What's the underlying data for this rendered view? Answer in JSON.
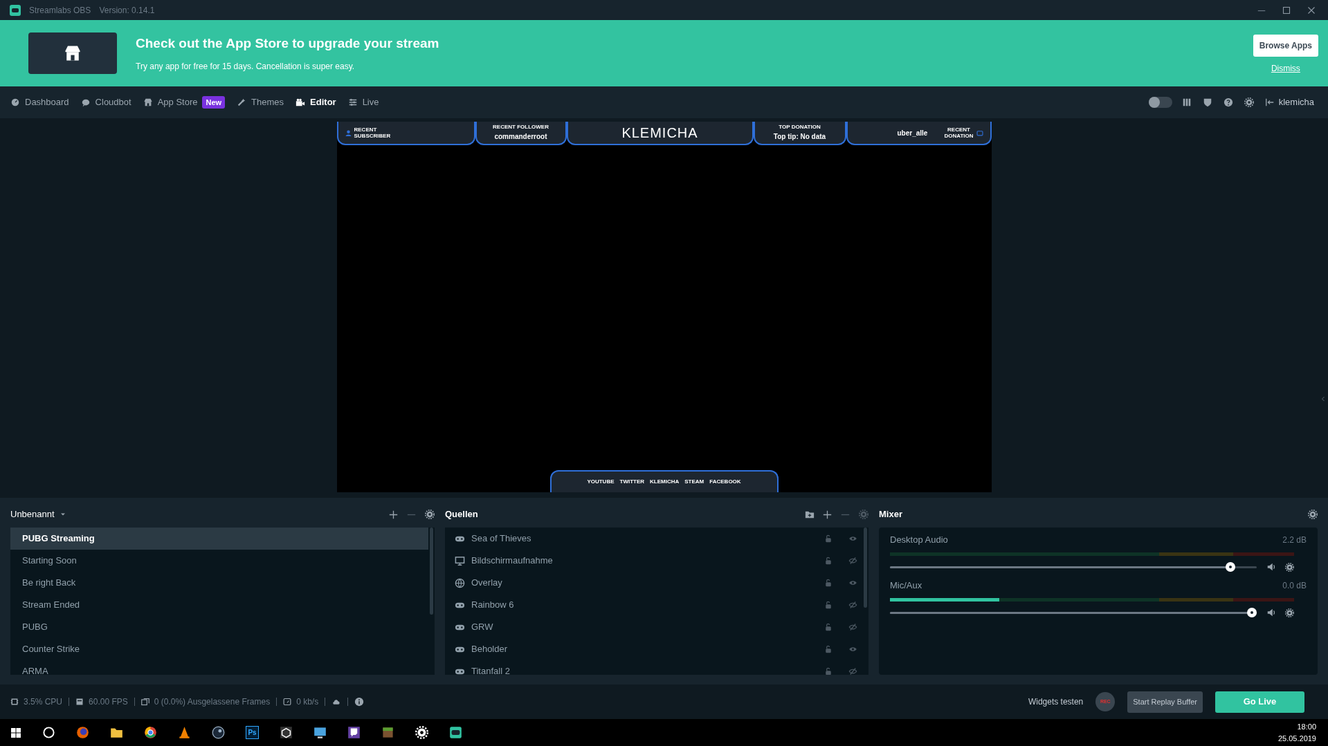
{
  "window": {
    "title": "Streamlabs OBS",
    "version": "Version: 0.14.1"
  },
  "banner": {
    "title": "Check out the App Store to upgrade your stream",
    "subtitle": "Try any app for free for 15 days. Cancellation is super easy.",
    "browse_button": "Browse Apps",
    "dismiss_link": "Dismiss"
  },
  "nav": {
    "items": [
      {
        "kind": "dashboard",
        "label": "Dashboard",
        "selected": false
      },
      {
        "kind": "cloudbot",
        "label": "Cloudbot",
        "selected": false
      },
      {
        "kind": "appstore",
        "label": "App Store",
        "badge": "New",
        "selected": false
      },
      {
        "kind": "themes",
        "label": "Themes",
        "selected": false
      },
      {
        "kind": "editor",
        "label": "Editor",
        "selected": true
      },
      {
        "kind": "live",
        "label": "Live",
        "selected": false
      }
    ],
    "night_mode": false,
    "user": "klemicha"
  },
  "overlay": {
    "top": [
      {
        "kind": "label",
        "lines": [
          "RECENT",
          "SUBSCRIBER"
        ]
      },
      {
        "kind": "stat",
        "caption": "RECENT FOLLOWER",
        "value": "commanderroot"
      },
      {
        "kind": "logo",
        "value": "KLEMICHA"
      },
      {
        "kind": "stat",
        "caption": "TOP DONATION",
        "value": "Top tip: No data"
      },
      {
        "kind": "stat-right",
        "value": "uber_alle",
        "lines": [
          "RECENT",
          "DONATION"
        ]
      }
    ],
    "socials": [
      "YOUTUBE",
      "TWITTER",
      "KLEMICHA",
      "STEAM",
      "FACEBOOK"
    ]
  },
  "scenes": {
    "collection": "Unbenannt",
    "items": [
      {
        "label": "PUBG Streaming",
        "selected": true
      },
      {
        "label": "Starting Soon",
        "selected": false
      },
      {
        "label": "Be right Back",
        "selected": false
      },
      {
        "label": "Stream Ended",
        "selected": false
      },
      {
        "label": "PUBG",
        "selected": false
      },
      {
        "label": "Counter Strike",
        "selected": false
      },
      {
        "label": "ARMA",
        "selected": false
      }
    ]
  },
  "sources": {
    "title": "Quellen",
    "items": [
      {
        "kind": "game",
        "label": "Sea of Thieves",
        "visible": true
      },
      {
        "kind": "display",
        "label": "Bildschirmaufnahme",
        "visible": false
      },
      {
        "kind": "browser",
        "label": "Overlay",
        "visible": true
      },
      {
        "kind": "game",
        "label": "Rainbow 6",
        "visible": false
      },
      {
        "kind": "game",
        "label": "GRW",
        "visible": false
      },
      {
        "kind": "game",
        "label": "Beholder",
        "visible": true
      },
      {
        "kind": "game",
        "label": "Titanfall 2",
        "visible": false
      }
    ]
  },
  "mixer": {
    "title": "Mixer",
    "channels": [
      {
        "name": "Desktop Audio",
        "reading": "2.2 dB",
        "level": 0.94,
        "meter": {
          "level": 0
        }
      },
      {
        "name": "Mic/Aux",
        "reading": "0.0 dB",
        "level": 1,
        "meter": {
          "level": 0.27
        }
      }
    ]
  },
  "status_bar": {
    "stats": [
      {
        "kind": "cpu",
        "text": "3.5% CPU"
      },
      {
        "kind": "fps",
        "text": "60.00 FPS"
      },
      {
        "kind": "frames",
        "text": "0 (0.0%) Ausgelassene Frames"
      },
      {
        "kind": "bitrate",
        "text": "0 kb/s"
      }
    ],
    "widgets_link": "Widgets testen",
    "rec_button": "REC",
    "replay_button": "Start Replay Buffer",
    "go_live_button": "Go Live"
  },
  "taskbar": {
    "apps": [
      {
        "kind": "search"
      },
      {
        "kind": "firefox"
      },
      {
        "kind": "explorer"
      },
      {
        "kind": "chrome"
      },
      {
        "kind": "vlc"
      },
      {
        "kind": "steam"
      },
      {
        "kind": "photoshop",
        "label": "Ps"
      },
      {
        "kind": "unity"
      },
      {
        "kind": "monitor"
      },
      {
        "kind": "twitch"
      },
      {
        "kind": "minecraft"
      },
      {
        "kind": "settings"
      },
      {
        "kind": "streamlabs"
      }
    ],
    "time": "18:00",
    "date": "25.05.2019"
  }
}
